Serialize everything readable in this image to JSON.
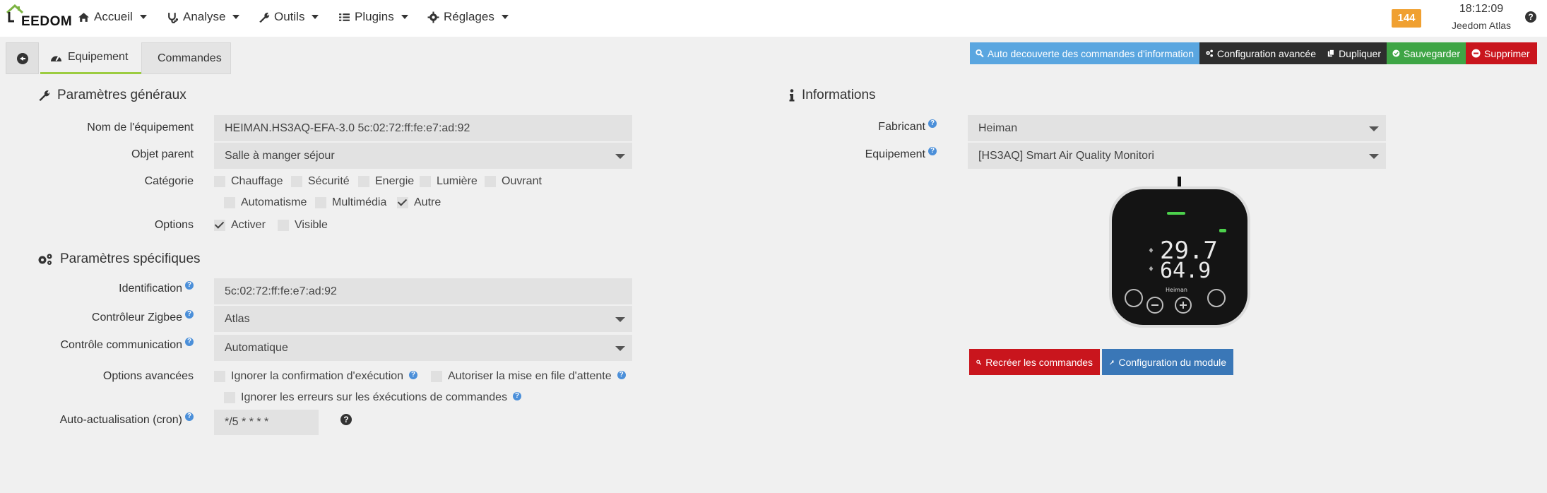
{
  "navbar": {
    "logo_text": "EEDOM",
    "menu": [
      {
        "label": "Accueil",
        "icon": "home-icon"
      },
      {
        "label": "Analyse",
        "icon": "stethoscope-icon"
      },
      {
        "label": "Outils",
        "icon": "wrench-icon"
      },
      {
        "label": "Plugins",
        "icon": "list-icon"
      },
      {
        "label": "Réglages",
        "icon": "gear-icon"
      }
    ],
    "badge_count": "144",
    "time": "18:12:09",
    "user": "Jeedom Atlas",
    "help": "?"
  },
  "tabs": {
    "equipement": "Equipement",
    "commandes": "Commandes"
  },
  "actions": {
    "auto_discovery": "Auto decouverte des commandes d'information",
    "advanced_config": "Configuration avancée",
    "duplicate": "Dupliquer",
    "save": "Sauvegarder",
    "delete": "Supprimer"
  },
  "colors": {
    "auto_discovery": "#5aa6e0",
    "dark": "#2e2e2e",
    "save": "#3ea545",
    "delete": "#c9151d",
    "recreate": "#c9151d",
    "module_config": "#3a77b7",
    "badge": "#f0a030",
    "active_tab_underline": "#9ccc40"
  },
  "general": {
    "title": "Paramètres généraux",
    "name_label": "Nom de l'équipement",
    "name_value": "HEIMAN.HS3AQ-EFA-3.0 5c:02:72:ff:fe:e7:ad:92",
    "parent_label": "Objet parent",
    "parent_value": "Salle à manger séjour",
    "category_label": "Catégorie",
    "categories": [
      {
        "label": "Chauffage",
        "checked": false
      },
      {
        "label": "Sécurité",
        "checked": false
      },
      {
        "label": "Energie",
        "checked": false
      },
      {
        "label": "Lumière",
        "checked": false
      },
      {
        "label": "Ouvrant",
        "checked": false
      },
      {
        "label": "Automatisme",
        "checked": false
      },
      {
        "label": "Multimédia",
        "checked": false
      },
      {
        "label": "Autre",
        "checked": true
      }
    ],
    "options_label": "Options",
    "options": [
      {
        "label": "Activer",
        "checked": true
      },
      {
        "label": "Visible",
        "checked": false
      }
    ]
  },
  "specific": {
    "title": "Paramètres spécifiques",
    "id_label": "Identification",
    "id_value": "5c:02:72:ff:fe:e7:ad:92",
    "controller_label": "Contrôleur Zigbee",
    "controller_value": "Atlas",
    "comm_label": "Contrôle communication",
    "comm_value": "Automatique",
    "advanced_label": "Options avancées",
    "advanced_opts": [
      {
        "label": "Ignorer la confirmation d'exécution",
        "checked": false
      },
      {
        "label": "Autoriser la mise en file d'attente",
        "checked": false
      },
      {
        "label": "Ignorer les erreurs sur les éxécutions de commandes",
        "checked": false
      }
    ],
    "cron_label": "Auto-actualisation (cron)",
    "cron_value": "*/5 * * * *"
  },
  "info": {
    "title": "Informations",
    "manufacturer_label": "Fabricant",
    "manufacturer_value": "Heiman",
    "equipment_label": "Equipement",
    "equipment_value": "[HS3AQ] Smart Air Quality Monitori",
    "device_temp": "29.7",
    "device_hum": "64.9",
    "device_brand": "Heiman",
    "recreate_label": "Recréer les commandes",
    "module_config_label": "Configuration du module"
  }
}
